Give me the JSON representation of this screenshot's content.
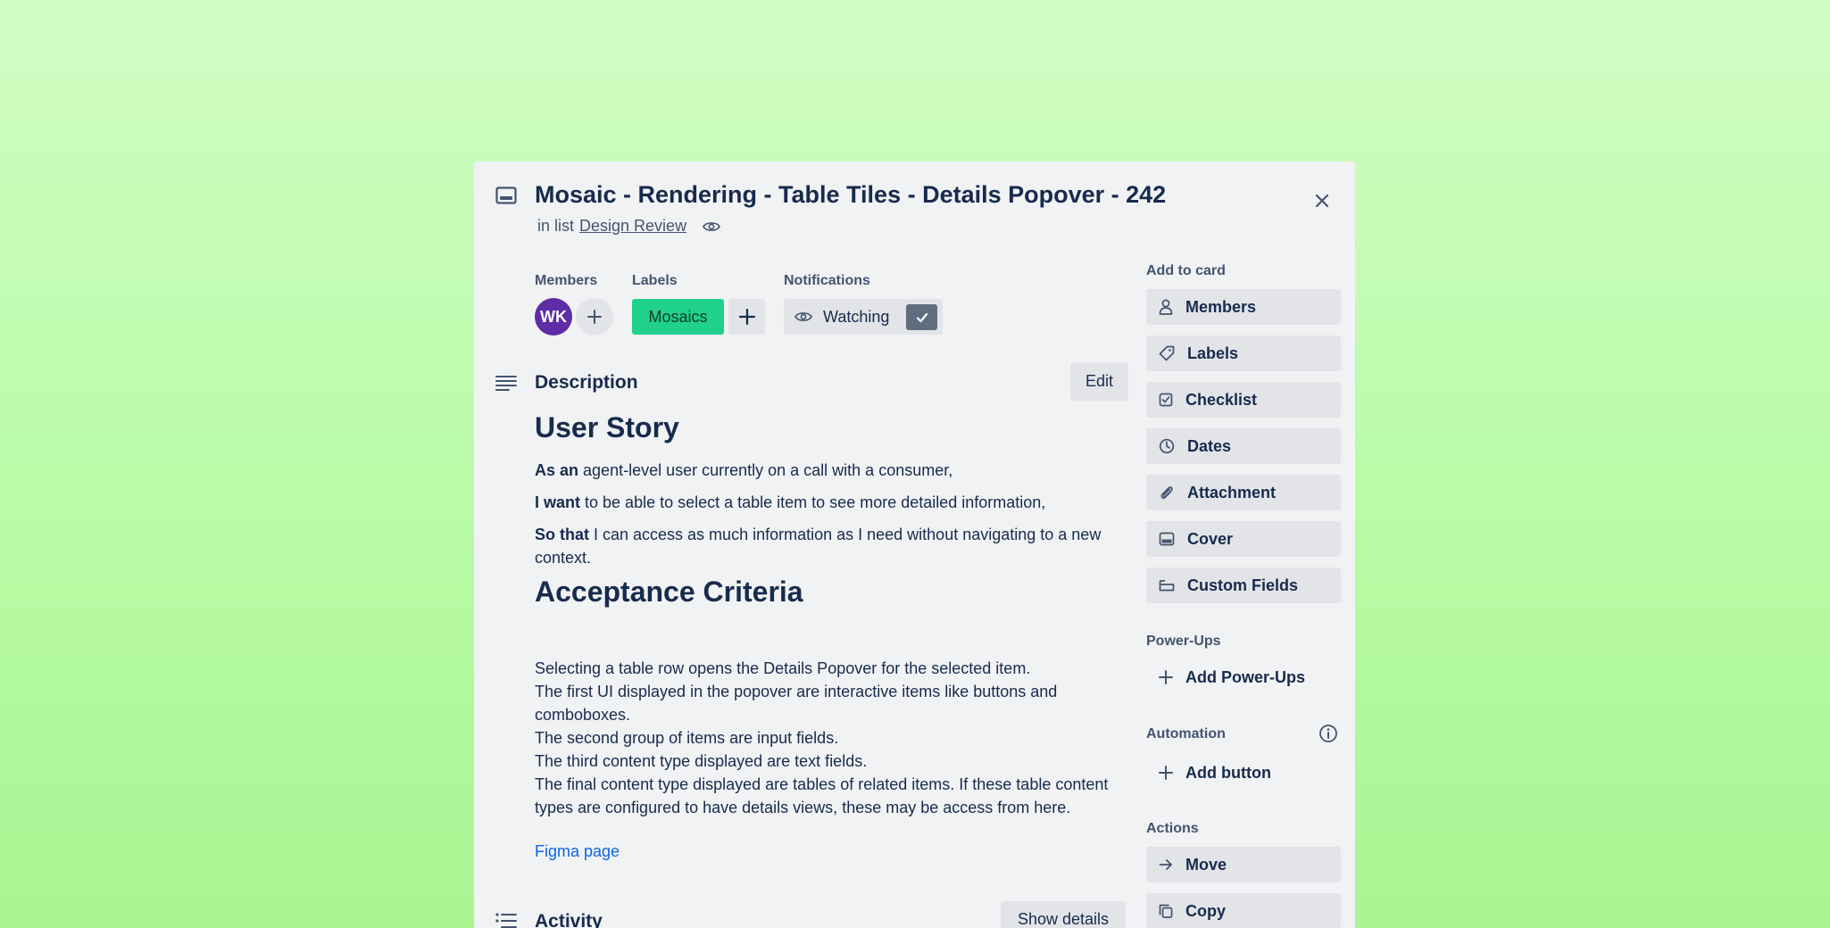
{
  "card": {
    "title": "Mosaic - Rendering - Table Tiles - Details Popover - 242",
    "in_list_prefix": "in list",
    "list_name": "Design Review"
  },
  "members": {
    "label": "Members",
    "avatar_initials": "WK"
  },
  "labels": {
    "label": "Labels",
    "chip": "Mosaics",
    "chip_color": "#1fd18b"
  },
  "notifications": {
    "label": "Notifications",
    "watch_label": "Watching"
  },
  "description": {
    "title": "Description",
    "edit_label": "Edit",
    "story_heading": "User Story",
    "as_an_bold": "As an",
    "as_an_text": " agent-level user currently on a call with a consumer,",
    "i_want_bold": "I want",
    "i_want_text": " to be able to select a table item to see more detailed information,",
    "so_that_bold": "So that",
    "so_that_text": " I can access as much information as I need without navigating to a new context.",
    "criteria_heading": "Acceptance Criteria",
    "criteria": [
      "Selecting a table row opens the Details Popover for the selected item.",
      "The first UI displayed in the popover are interactive items like buttons and comboboxes.",
      "The second group of items are input fields.",
      "The third content type displayed are text fields.",
      "The final content type displayed are tables of related items. If these table content types are configured to have details views, these may be access from here."
    ],
    "link_text": "Figma page"
  },
  "activity": {
    "title": "Activity",
    "show_details_label": "Show details"
  },
  "sidebar": {
    "add_to_card_label": "Add to card",
    "add_to_card": [
      {
        "label": "Members",
        "icon": "person-icon"
      },
      {
        "label": "Labels",
        "icon": "tag-icon"
      },
      {
        "label": "Checklist",
        "icon": "checklist-icon"
      },
      {
        "label": "Dates",
        "icon": "clock-icon"
      },
      {
        "label": "Attachment",
        "icon": "paperclip-icon"
      },
      {
        "label": "Cover",
        "icon": "cover-icon"
      },
      {
        "label": "Custom Fields",
        "icon": "custom-fields-icon"
      }
    ],
    "power_ups_label": "Power-Ups",
    "add_power_ups": "Add Power-Ups",
    "automation_label": "Automation",
    "add_button": "Add button",
    "actions_label": "Actions",
    "actions": [
      {
        "label": "Move",
        "icon": "arrow-right-icon"
      },
      {
        "label": "Copy",
        "icon": "copy-icon"
      }
    ]
  },
  "colors": {
    "background": "#b9fba6",
    "card": "#f1f2f4",
    "avatar": "#5e2ca5",
    "link": "#0c66e4"
  }
}
